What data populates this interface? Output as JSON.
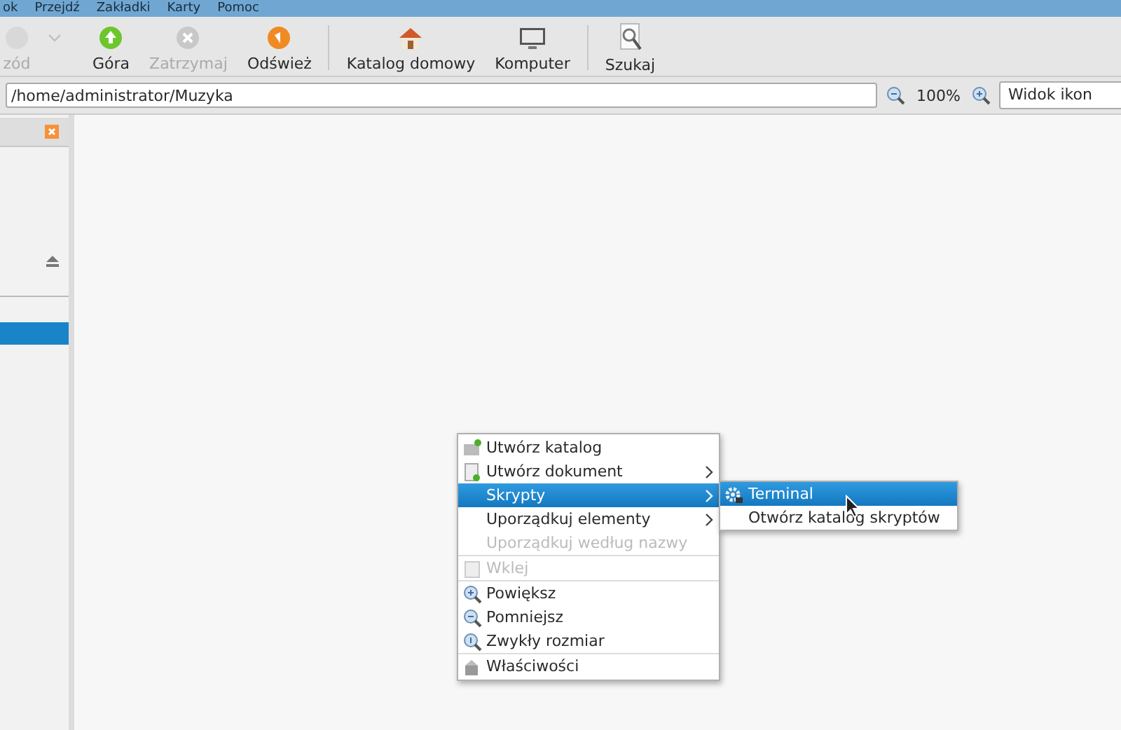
{
  "menu_bar": [
    "ok",
    "Przejdź",
    "Zakładki",
    "Karty",
    "Pomoc"
  ],
  "toolbar": [
    {
      "kind": "button",
      "label": "zód",
      "disabled": true
    },
    {
      "kind": "dropdown",
      "disabled": true
    },
    {
      "kind": "button",
      "label": "Góra",
      "disabled": false
    },
    {
      "kind": "button",
      "label": "Zatrzymaj",
      "disabled": true
    },
    {
      "kind": "button",
      "label": "Odśwież",
      "disabled": false
    },
    {
      "kind": "separator"
    },
    {
      "kind": "button",
      "label": "Katalog domowy",
      "disabled": false
    },
    {
      "kind": "button",
      "label": "Komputer",
      "disabled": false
    },
    {
      "kind": "separator"
    },
    {
      "kind": "button",
      "label": "Szukaj",
      "disabled": false
    }
  ],
  "location": {
    "value": "/home/administrator/Muzyka",
    "zoom": "100%",
    "view": "Widok ikon"
  },
  "context_menu": [
    {
      "kind": "item",
      "label": "Utwórz katalog",
      "disabled": false,
      "submenu": false,
      "selected": false
    },
    {
      "kind": "item",
      "label": "Utwórz dokument",
      "disabled": false,
      "submenu": true,
      "selected": false
    },
    {
      "kind": "item",
      "label": "Skrypty",
      "disabled": false,
      "submenu": true,
      "selected": true
    },
    {
      "kind": "item",
      "label": "Uporządkuj elementy",
      "disabled": false,
      "submenu": true,
      "selected": false
    },
    {
      "kind": "item",
      "label": "Uporządkuj według nazwy",
      "disabled": true,
      "submenu": false,
      "selected": false
    },
    {
      "kind": "separator"
    },
    {
      "kind": "item",
      "label": "Wklej",
      "disabled": true,
      "submenu": false,
      "selected": false
    },
    {
      "kind": "separator"
    },
    {
      "kind": "item",
      "label": "Powiększ",
      "disabled": false,
      "submenu": false,
      "selected": false
    },
    {
      "kind": "item",
      "label": "Pomniejsz",
      "disabled": false,
      "submenu": false,
      "selected": false
    },
    {
      "kind": "item",
      "label": "Zwykły rozmiar",
      "disabled": false,
      "submenu": false,
      "selected": false
    },
    {
      "kind": "separator"
    },
    {
      "kind": "item",
      "label": "Właściwości",
      "disabled": false,
      "submenu": false,
      "selected": false
    }
  ],
  "submenu": [
    {
      "label": "Terminal",
      "selected": true
    },
    {
      "label": "Otwórz katalog skryptów",
      "selected": false
    }
  ]
}
